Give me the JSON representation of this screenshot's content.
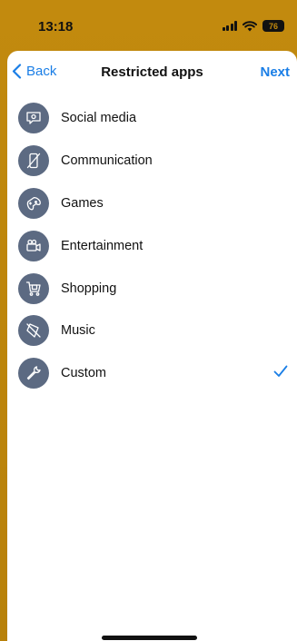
{
  "status": {
    "time": "13:18",
    "battery": "76"
  },
  "nav": {
    "back_label": "Back",
    "title": "Restricted apps",
    "next_label": "Next"
  },
  "categories": [
    {
      "label": "Social media",
      "icon": "chat-bubble-icon",
      "selected": false
    },
    {
      "label": "Communication",
      "icon": "phone-off-icon",
      "selected": false
    },
    {
      "label": "Games",
      "icon": "gamepad-icon",
      "selected": false
    },
    {
      "label": "Entertainment",
      "icon": "video-camera-icon",
      "selected": false
    },
    {
      "label": "Shopping",
      "icon": "shopping-cart-icon",
      "selected": false
    },
    {
      "label": "Music",
      "icon": "music-off-icon",
      "selected": false
    },
    {
      "label": "Custom",
      "icon": "wrench-icon",
      "selected": true
    }
  ],
  "colors": {
    "accent": "#1a7ee6",
    "icon_bg": "#5c6a82",
    "header_bg": "#c28a0e"
  }
}
